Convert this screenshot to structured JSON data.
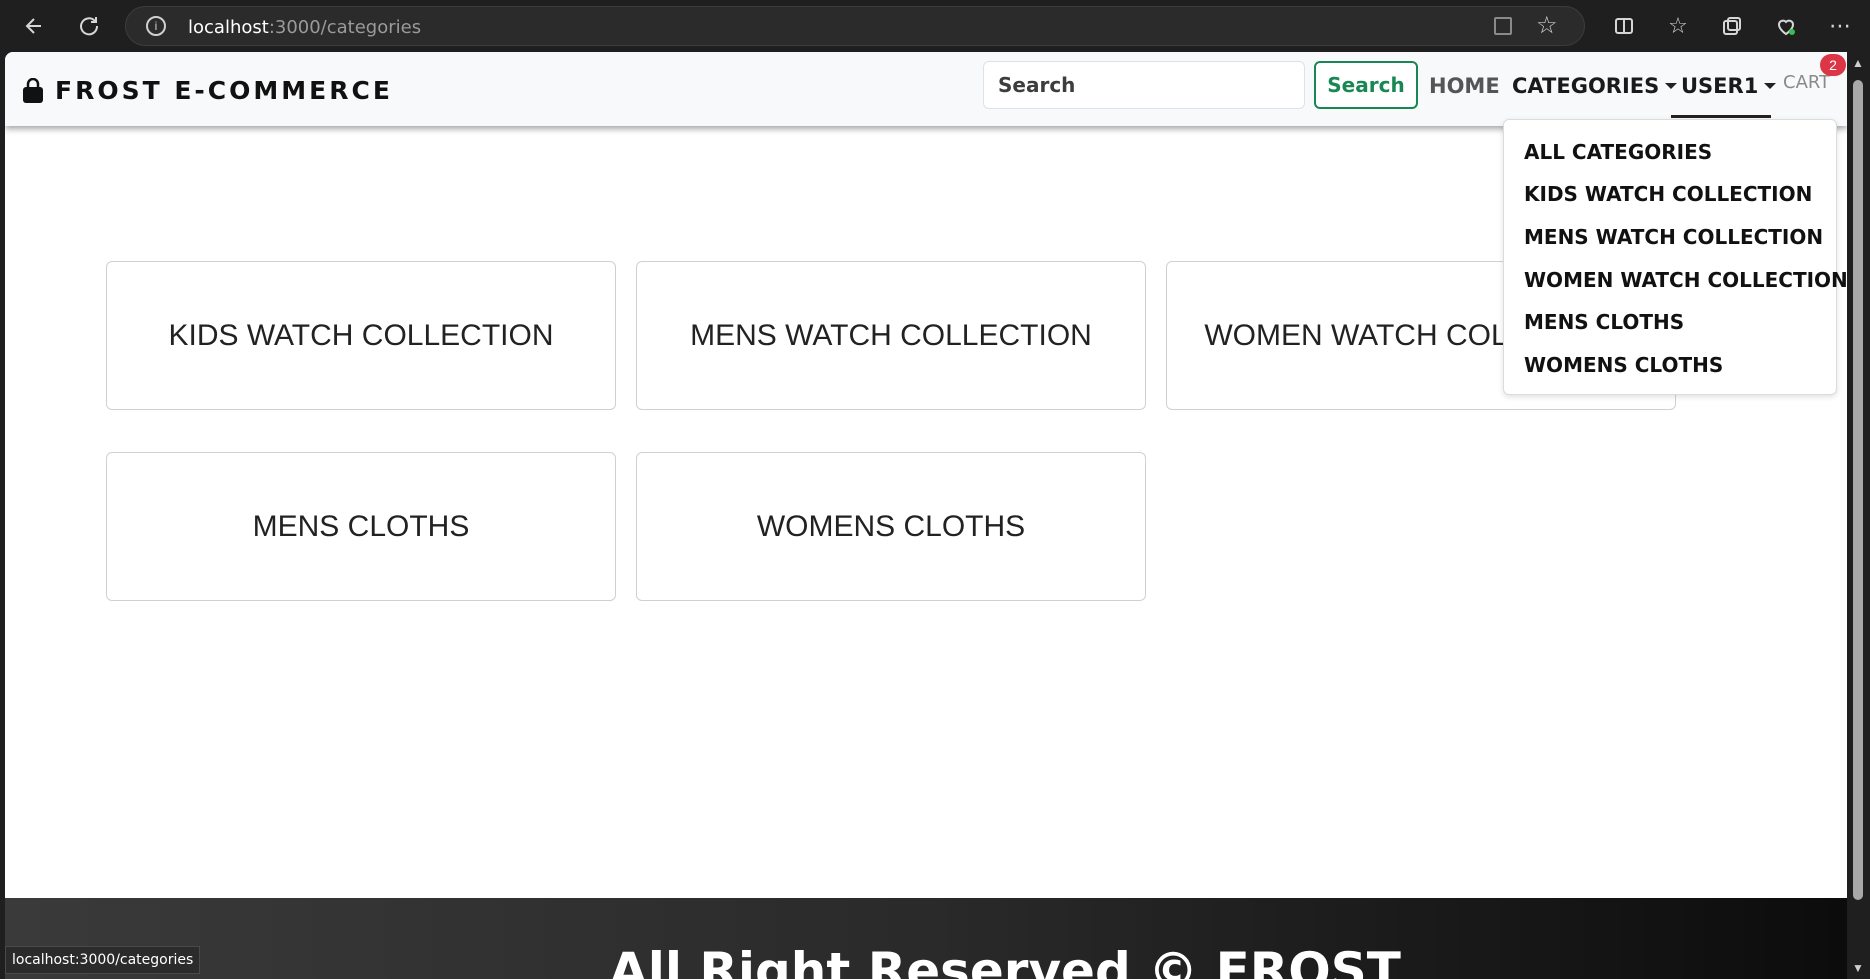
{
  "browser": {
    "url_host": "localhost",
    "url_path": ":3000/categories",
    "status_url": "localhost:3000/categories"
  },
  "navbar": {
    "brand": "FROST E-COMMERCE",
    "search_placeholder": "Search",
    "search_button": "Search",
    "home": "HOME",
    "categories": "CATEGORIES",
    "user": "USER1",
    "cart": "CART",
    "cart_count": "2"
  },
  "dropdown": {
    "items": [
      "ALL CATEGORIES",
      "KIDS WATCH COLLECTION",
      "MENS WATCH COLLECTION",
      "WOMEN WATCH COLLECTION",
      "MENS CLOTHS",
      "WOMENS CLOTHS"
    ]
  },
  "categories": [
    "KIDS WATCH COLLECTION",
    "MENS WATCH COLLECTION",
    "WOMEN WATCH COLLECTION",
    "MENS CLOTHS",
    "WOMENS CLOTHS"
  ],
  "footer": {
    "text": "All Right Reserved © FROST"
  },
  "colors": {
    "accent_green": "#198754",
    "badge_red": "#dc3545"
  }
}
